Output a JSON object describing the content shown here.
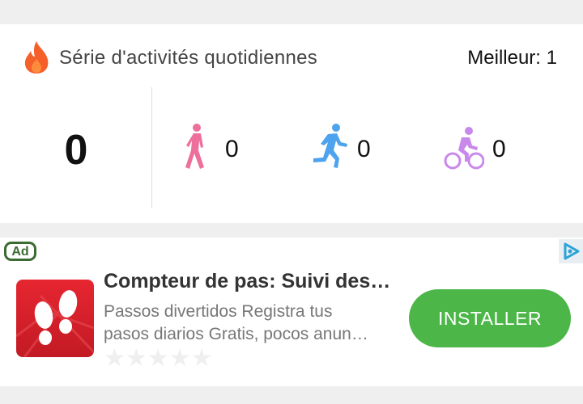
{
  "streak": {
    "title": "Série d'activités quotidiennes",
    "best_label": "Meilleur",
    "best_separator": ": ",
    "best_value": "1",
    "count": "0",
    "activities": [
      {
        "type": "walk",
        "icon": "walking-icon",
        "value": "0",
        "color": "#ec6f9c"
      },
      {
        "type": "run",
        "icon": "running-icon",
        "value": "0",
        "color": "#4ea3ee"
      },
      {
        "type": "bike",
        "icon": "cycling-icon",
        "value": "0",
        "color": "#c889ea"
      }
    ]
  },
  "ad": {
    "badge": "Ad",
    "title": "Compteur de pas: Suivi des…",
    "description_line1": "Passos divertidos Registra tus",
    "description_line2": "pasos diarios Gratis, pocos anun…",
    "rating_stars": "★★★★★",
    "install_label": "INSTALLER",
    "install_color": "#4cb648",
    "app_icon": "footsteps-app-icon",
    "adchoices_icon": "adchoices-icon"
  },
  "colors": {
    "background": "#efefef",
    "fire": "#f5602a",
    "badge_green": "#3b6b32"
  }
}
